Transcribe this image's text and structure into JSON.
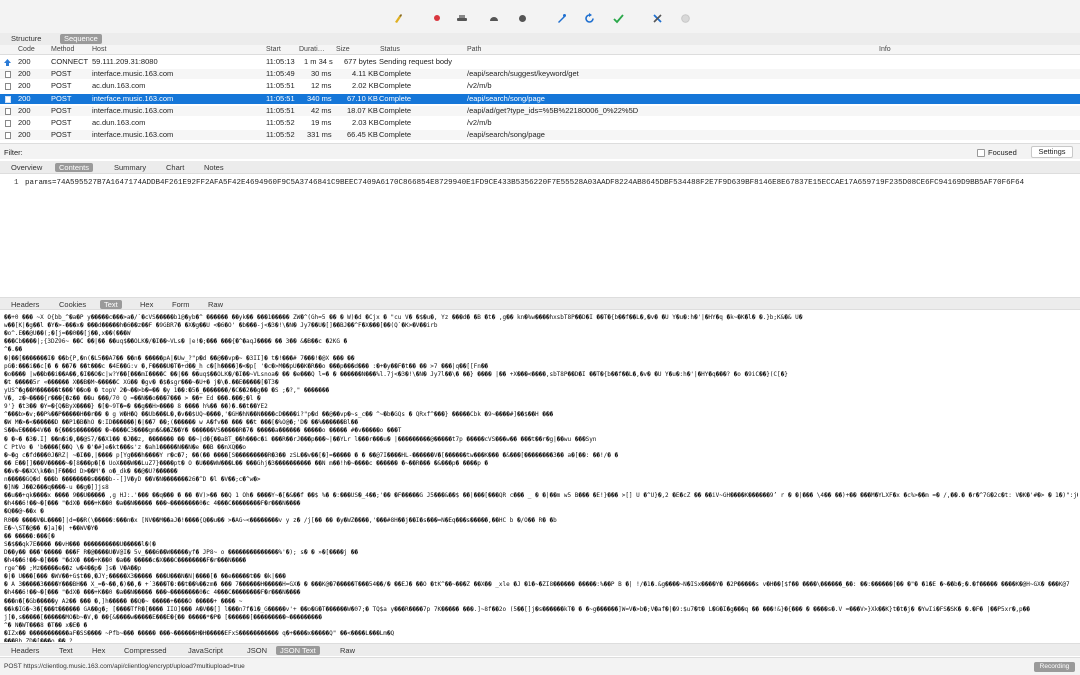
{
  "toolbar": {
    "icons": [
      "broom-icon",
      "record-icon",
      "throttle-icon",
      "breakpoint-icon",
      "compose-icon",
      "repeat-icon",
      "validate-icon",
      "tools-icon",
      "settings-icon"
    ]
  },
  "view_tabs": [
    "Structure",
    "Sequence"
  ],
  "columns": {
    "code": "Code",
    "method": "Method",
    "host": "Host",
    "start": "Start",
    "duration": "Durati…",
    "size": "Size",
    "status": "Status",
    "path": "Path",
    "info": "Info"
  },
  "rows": [
    {
      "code": "200",
      "method": "CONNECT",
      "host": "59.111.209.31:8080",
      "start": "11:05:13",
      "duration": "1 m 34 s",
      "size": "677 bytes",
      "status": "Sending request body",
      "path": "",
      "icon": "upload-arrow-icon"
    },
    {
      "code": "200",
      "method": "POST",
      "host": "interface.music.163.com",
      "start": "11:05:49",
      "duration": "30 ms",
      "size": "4.11 KB",
      "status": "Complete",
      "path": "/eapi/search/suggest/keyword/get",
      "icon": "document-icon"
    },
    {
      "code": "200",
      "method": "POST",
      "host": "ac.dun.163.com",
      "start": "11:05:51",
      "duration": "12 ms",
      "size": "2.02 KB",
      "status": "Complete",
      "path": "/v2/m/b",
      "icon": "document-icon"
    },
    {
      "code": "200",
      "method": "POST",
      "host": "interface.music.163.com",
      "start": "11:05:51",
      "duration": "340 ms",
      "size": "67.10 KB",
      "status": "Complete",
      "path": "/eapi/search/song/page",
      "icon": "document-icon"
    },
    {
      "code": "200",
      "method": "POST",
      "host": "interface.music.163.com",
      "start": "11:05:51",
      "duration": "42 ms",
      "size": "18.07 KB",
      "status": "Complete",
      "path": "/eapi/ad/get?type_ids=%5B%22180006_0%22%5D",
      "icon": "document-icon"
    },
    {
      "code": "200",
      "method": "POST",
      "host": "ac.dun.163.com",
      "start": "11:05:52",
      "duration": "19 ms",
      "size": "2.03 KB",
      "status": "Complete",
      "path": "/v2/m/b",
      "icon": "document-icon"
    },
    {
      "code": "200",
      "method": "POST",
      "host": "interface.music.163.com",
      "start": "11:05:52",
      "duration": "331 ms",
      "size": "66.45 KB",
      "status": "Complete",
      "path": "/eapi/search/song/page",
      "icon": "document-icon"
    }
  ],
  "selected_row": 3,
  "filter": {
    "label": "Filter:",
    "focused_label": "Focused",
    "settings_label": "Settings"
  },
  "content_tabs": [
    "Overview",
    "Contents",
    "Summary",
    "Chart",
    "Notes"
  ],
  "request_body": {
    "line_number": "1",
    "params": "params=74A595527B7A1647174ADDB4F261E92FF2AFA5F42E4694960F9C5A3746841C9BEEC7409A6170C866854E8729940E1FD9CE433B5356220F7E55528A03AADF8224AB8645DBF534488F2E7F9D639BF8146E8E67837E15ECCAE17A659719F235D08CE6FC94169D9BB5AF70F6F64"
  },
  "response_tabs": [
    "Headers",
    "Cookies",
    "Text",
    "Hex",
    "Form",
    "Raw"
  ],
  "raw_lines": [
    "��+0 ��� ~X O{bb_^�a�P y�����c���>a�/`�cVS�����b1@�yb�^ ������ ��yk�� ���1����� ZW�^(Gh=5 �� � W)�d �Cjx � \"cu V� �$�u�, Yz ���d� �B �t� ,g�� kn�%w����hxsbT8P��D�I ��T�{b��f��L�,�v� �U Y�u�:h�'|�HY�q �k~�K�l� �.}b;K&�& U�",
    "w��[K|�g��l �Y�>-���x� ���d�����h�6��z��F �9GBR7� �X�g��U <�6�O' �b���-j<�3�!\\�N� Jy7��U�[]��BJ��^F�X���[��(Q`�K>�V��irb",
    "�o^.E��@U��(;�[j=��0��[j��,x��(���W",
    "���Cb����|;{3DZ96~ ��C ��|�� ��uq$��OLK�/�I��~VLs� |e!�;��� ���{�^�aqJ���� �� 3�� &�B��c �2KG �",
    "^�.��",
    "�|��[�������I� ��b{P,�n(�L5��A7�� ��n� �����pA|�Uw_?\"p�d ��@��vp�~­ �3II]� t�!���# 7���!�@X ��� ��­",
    " pG�:���i��c[� � ��7� ��t���c �4E��G:v �,F����U�T�+d��_h c�[h����]�<�p[ '�c�>M��pU��K�R��o ���p���d��� :�+�y��F�t�� �� >7 ���|q��[[Fn��",
    "�o���� |w��b��i��A��,�I��O�c|w?Y��[���mI����C ��|�� ��uq$��OLK�/�I��~VLsnoa� �� �e���Q l=� � ������N���%l.7j<�3�!\\�N� Jy7l��\\� ��} ���� |�� +X���<����,sbT8P��D�I ��T�{b��f��L�,�v� �U Y�u�:h�'|�HY�q���? �o �9iC��}(C[�}",
    "�t �����5r «������ X��B�M~�����C XG�� �gv� �$�sgr���~�U+� j�\\�.��E�����[�T3�",
    "yUS^�g��M������t���'��o� � topV 2�~��>b�=�� �y 1��:�5�_�������/�C��2��g�� �S ;�?,\" �������",
    " V�, z�~����{r���{�z�� ��u ���/70 Q =��N��o���7��� > ��+ Ed ���.���;�l �",
    "9'} �t3�� �Y=�{Q�ByX����} �[�~9T�=� ��g��H>���� 8 ���� h%�� ��)�.��t��YE2",
    "^���b>�v;��P%��P�����H��r�� � g W�H�Q ��Ub���L�,�v��$UQ~����,'�GH�hN��N����cD����i?\"p�d ��@��vp�~s_c�� ^~�b�GQs � QRxf^���} �����Cbk �9~����#]��$��H ���",
    "�W M�>�<������D ��P1�B�hO �:ID������|�|��7 ��;(������ w A�fv�� ��� ��t ���[�%O@�;'D� ��%������Bl��",
    "S��wE����4V��   �{���$������� �~����C3����gm�&��Z��Y� ������VS�����R�7� �����a������ �����o ����� #�v�����o ���T",
    "� �~� �3�.I] ��m�i�,��@S7/��X1�� �J��z,    ������� �� ��~|d�{��aBT_��h���c�i ���R��rJ���p���~|��YLr l���r���u�  |���������@�����t7p  �����cVS���w��  ���t��r�g|��wu  ���Syn",
    "C PtVo � 'b����[��Q \\� �'�#]e�kt���s'z �ah1�����N��N�e ��B ��nXQ��o",
    "�~�g c�fd���0J�RZ| ~�I��,|���� p[Yg���h����Y r�c�7; ��(�� ����[S���������R�3�� zSL��v��[�]=�����  � � ��@7I����HL-������V�[������tw���K���  �&���[��������3�� a�[��: ��!/� �",
    "��  E��[]���V�����~�[8���p�[� UoX���W��LuZ7}����pt� O �U���WW���L�� ���Ghj�3���������� ��N  m��!h�~����c ������ �~��R��� �&���p� ����p �",
    "��v�~��XX\\k��n]F���d  D>��M'� o�_dk� ��@�U?������",
    "n�����GQ�d  ���b ��������s����b--[]V�yD ��V�N�������26�^D �l �V��;c�^w�>",
    "�]N� J��2���q����-u ��g�]]js8",
    "��u��+qk����x ���� 9��U�����   ,g HJ:.'��� ��q��� � �� �V)>�� ��Q 1 Oh� ����Y~�[�&��f ��$ %� �:���US�_4��;'�� �F�����G J5���&��$ ��|���[���QR c��� _ � �|��m w5 B��� �E!}��� >[] U �^U}�,2 �E�cZ �� ��iV~GH����K������9’ r � �|��� \\4�� ��)+�� ���M�YLXF�x �c%>��m =�  /,��.� �r�^7G�2c�t: V�K�'#�> � 1�)\":j�[ ��W",
    "�h4��6!��~�[��� \"�dX� ���+K��0 �a��N����� ���~��������0�c 4���C��������F�r���N����",
    "�Q��@~��x �",
    "R0�� ����V�L����]|d=��R(\\�����:���n�x [NV��M��aJ�!����{Q��u�� >�AG~<��������v    y z� /j[�� �� �y�WZ����,'���#8H��j��I�s���=N�Eq���s�����,��HC b �/O�� R� �b",
    "E�~\\ST�@�� �]a]�| +��WV�Y�",
    "�� �����:���[�",
    "S�$��qk7E���� ��vH��� ����������U�����l�(�",
    "D��y�� ���'����� ���F R�@����U�V@I� 5v_���6��W�����yf� JP8~ o ��������������%'�); s� � »�[����j ��",
    "�h4��6!��~�[��� \"�dX� ���+K��0 �a�� �����c�X���C��������F�r���N����",
    "rge^�� ;Mz�����e��z w�4��p� ]s� V�A��p",
    "�|� U���[��� �WV��+G$t��,�JY;�����X3����� ���U���N�N|����[� ��e�����t�� �k|���",
    "� A 3�����3����Y���BH�� X_=�~��,�)��,� +´3���T�:��t��%��zm� ��� 7������H�����H=GX� � ���K@�7�����T���54��/�   ��EJ� ��O �tK^��~���Z ��X�� _xle �J �1�~�ZI8������ �����:%��P  B �|  !/�1�.&g����~N�ISx����Y� �2P�����s v�H��[$f�� ����\\������_��: ��:������[�� �\"� �1�E �~��b�;�.�f����� ����K�@H~GX� ���K@7",
    "�h4��6!��~�[��� \"�dX� ���+K��0 �a��N����� ���~��������0�c 4���C��������F�r���N����",
    "���n�[�Gb�����y A2�� ��� �,]h����� ��Q�~  �����+����O �����+ ���� ~",
    "��k�IG�~3�[���t������ GA��g�; [����TfR�[���� IIO]��� A�V��[] l���n7f�1�_G�����v'+ ��o�G�T������W�07;� TQ$a y���R����7p 7K�����  ���.]~8f��2o (5��[]j�s������kT� � �~g������]W=V�>b�;V�af�|�9:$u7�t� L�G�I�g���q �� ���!&}�{��� � ����s�.V =���V>}Xk��K}t�t�j� �YwIi�FS�SK� �.�F�  |��P5xr�,p��",
    "j[�,s�����[������MO�b~�V,� ��{&����w�����E���E�{�� �����*�P� [������[���������~���������",
    "^� N�WT���8 �T�� x�E� �",
    "�IZx�� �����������aF�SS���� ~Pfb~��� �����    ���~������H�H�����EFxS����������� q�+����x�����Q\" ��<����L���Lm�Q",
    "���Bh ZD�[���o ��  ?"
  ],
  "body_tabs": [
    "Headers",
    "Text",
    "Hex",
    "Compressed",
    "JavaScript",
    "JSON",
    "JSON Text",
    "Raw"
  ],
  "status_bar": {
    "text": "POST https://clientlog.music.163.com/api/clientlog/encrypt/upload?multiupload=true",
    "recording": "Recording"
  },
  "colors": {
    "selection": "#1576d8",
    "tab_active": "#9a9a9a",
    "toolbar_bg": "#f3f3f3",
    "broom": "#e0b020",
    "record": "#d9363e",
    "validate": "#2aa84a",
    "tools": "#1e6fd0"
  }
}
